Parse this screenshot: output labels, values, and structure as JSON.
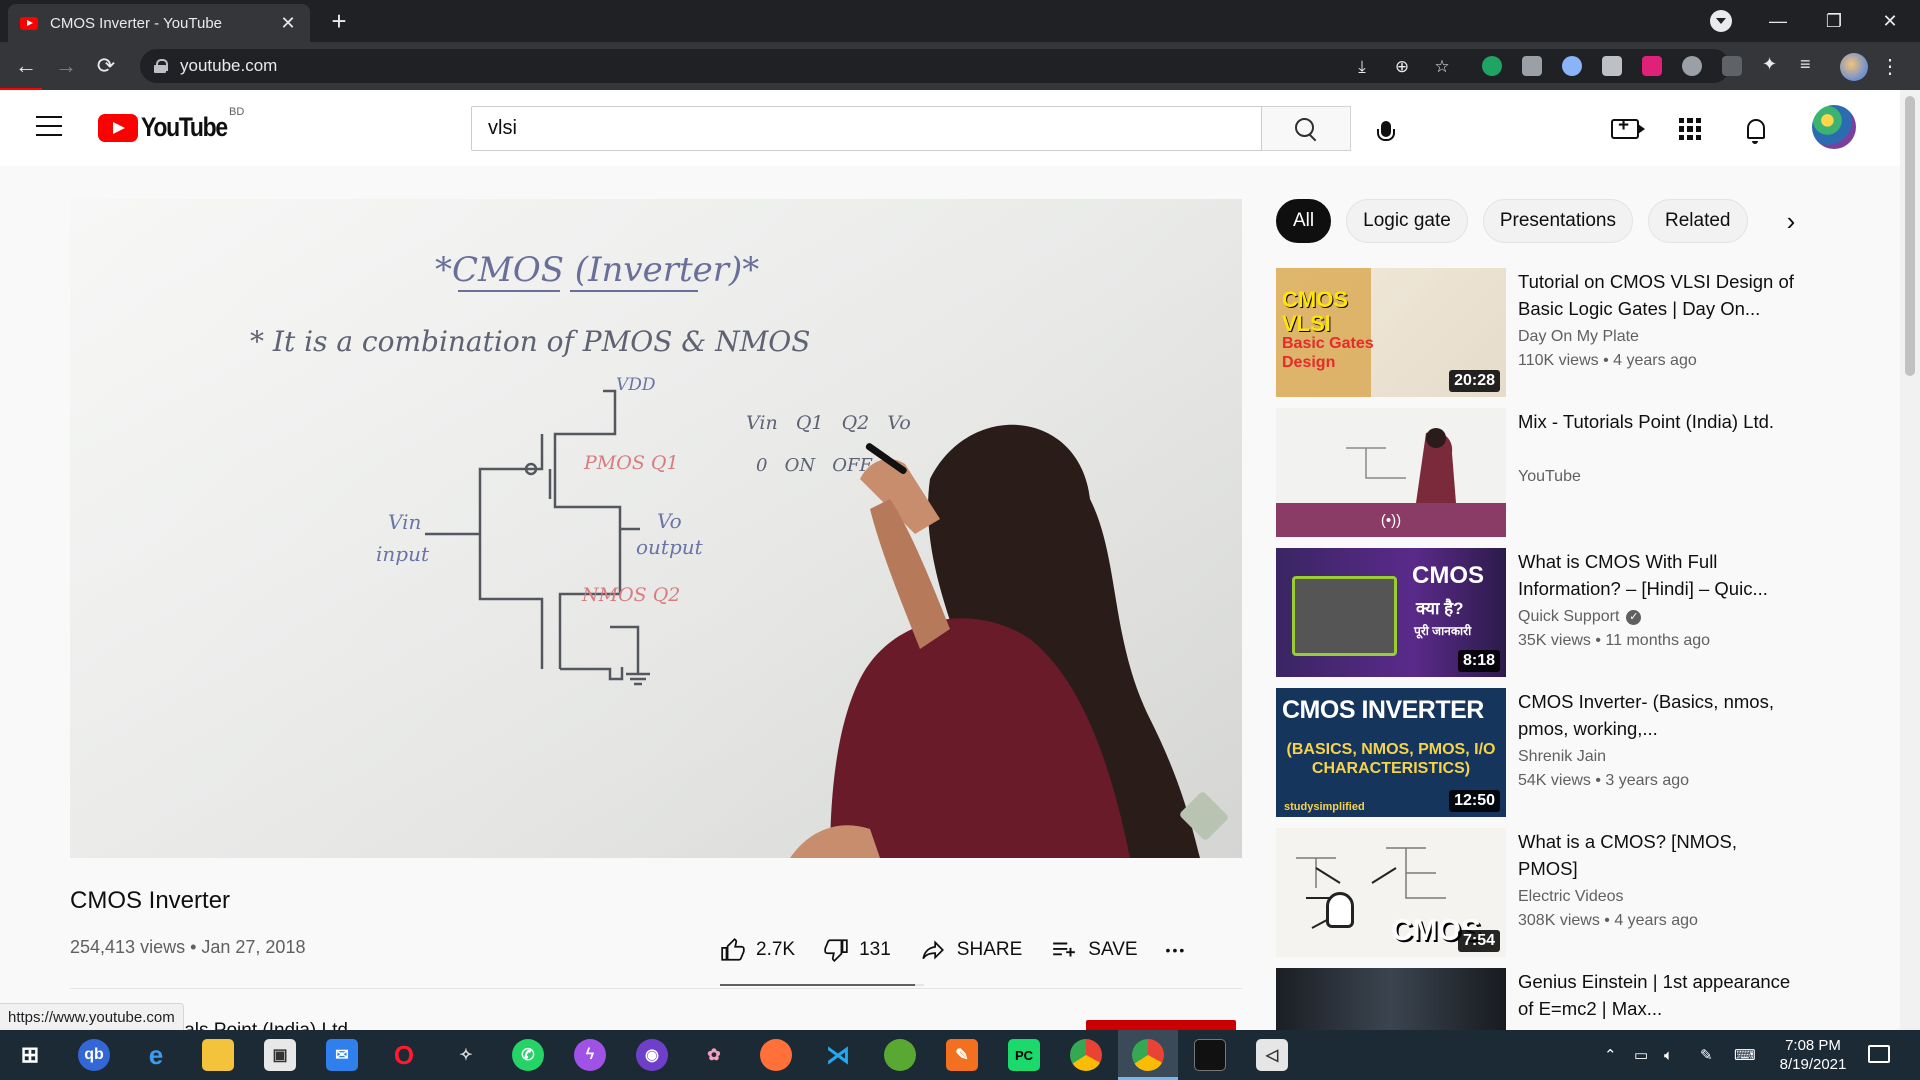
{
  "browser": {
    "tab_title": "CMOS Inverter - YouTube",
    "url": "youtube.com",
    "tab_close": "✕",
    "new_tab": "+",
    "status_url": "https://www.youtube.com"
  },
  "masthead": {
    "logo_text": "YouTube",
    "country": "BD",
    "search_value": "vlsi"
  },
  "video": {
    "title": "CMOS Inverter",
    "meta": "254,413 views • Jan 27, 2018",
    "likes": "2.7K",
    "dislikes": "131",
    "like_ratio": 0.954,
    "share_label": "SHARE",
    "save_label": "SAVE",
    "more": "•••",
    "channel_partial": "ials Point (India) Ltd."
  },
  "chips": [
    "All",
    "Logic gate",
    "Presentations",
    "Related"
  ],
  "recommendations": [
    {
      "title": "Tutorial on CMOS VLSI Design of Basic Logic Gates | Day On...",
      "channel": "Day On My Plate",
      "views": "110K views • 4 years ago",
      "duration": "20:28",
      "thumb_label": "CMOS VLSI",
      "thumb_sub": "Basic Gates Design"
    },
    {
      "title": "Mix - Tutorials Point (India) Ltd.",
      "channel": "YouTube",
      "views": "",
      "duration": "",
      "thumb_label": "(•))"
    },
    {
      "title": "What is CMOS With Full Information? – [Hindi] – Quic...",
      "channel": "Quick Support",
      "views": "35K views • 11 months ago",
      "duration": "8:18",
      "thumb_label": "CMOS",
      "thumb_sub": "क्या है?",
      "thumb_sub2": "पूरी जानकारी"
    },
    {
      "title": "CMOS Inverter- (Basics, nmos, pmos, working,...",
      "channel": "Shrenik Jain",
      "views": "54K views • 3 years ago",
      "duration": "12:50",
      "thumb_label": "CMOS INVERTER",
      "thumb_sub": "(BASICS, NMOS, PMOS, I/O CHARACTERISTICS)",
      "thumb_brand": "studysimplified"
    },
    {
      "title": "What is a CMOS? [NMOS, PMOS]",
      "channel": "Electric Videos",
      "views": "308K views • 4 years ago",
      "duration": "7:54",
      "thumb_label": "CMOS"
    },
    {
      "title": "Genius Einstein | 1st appearance of E=mc2 | Max...",
      "channel": "",
      "views": "",
      "duration": ""
    }
  ],
  "whiteboard": {
    "title": "*CMOS (Inverter)*",
    "line1": "* It is a combination of PMOS & NMOS",
    "vdd": "VDD",
    "pmos": "PMOS Q1",
    "nmos": "NMOS Q2",
    "vin": "Vin",
    "input": "input",
    "vo": "Vo",
    "output": "output",
    "table_header": "Vin   Q1   Q2   Vo",
    "table_row": "0   ON   OFF"
  },
  "taskbar": {
    "time": "7:08 PM",
    "date": "8/19/2021"
  },
  "colors": {
    "brand_red": "#ff0000",
    "chrome_dark": "#202124",
    "taskbar": "#1c2a36"
  }
}
